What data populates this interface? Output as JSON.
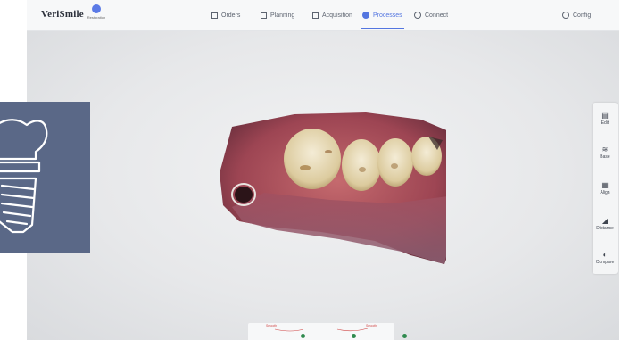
{
  "logo": {
    "text": "VeriSmile"
  },
  "app_badge": {
    "label": "Restoration"
  },
  "nav": {
    "orders": "Orders",
    "planning": "Planning",
    "acquisition": "Acquisition",
    "processes": "Processes",
    "connect": "Connect",
    "active": "processes"
  },
  "config": {
    "label": "Config"
  },
  "toolbar": {
    "edit": "Edit",
    "base": "Base",
    "align": "Align",
    "distance": "Distance",
    "compare": "Compare"
  },
  "bottom_panel": {
    "marker_left": "Smooth",
    "marker_right": "Smooth"
  },
  "colors": {
    "accent": "#5476e0",
    "overlay_card": "#5a6887",
    "gum": "#b0505a",
    "tooth": "#e8dcc0"
  },
  "icons": {
    "dental_implant": "implant-icon"
  }
}
